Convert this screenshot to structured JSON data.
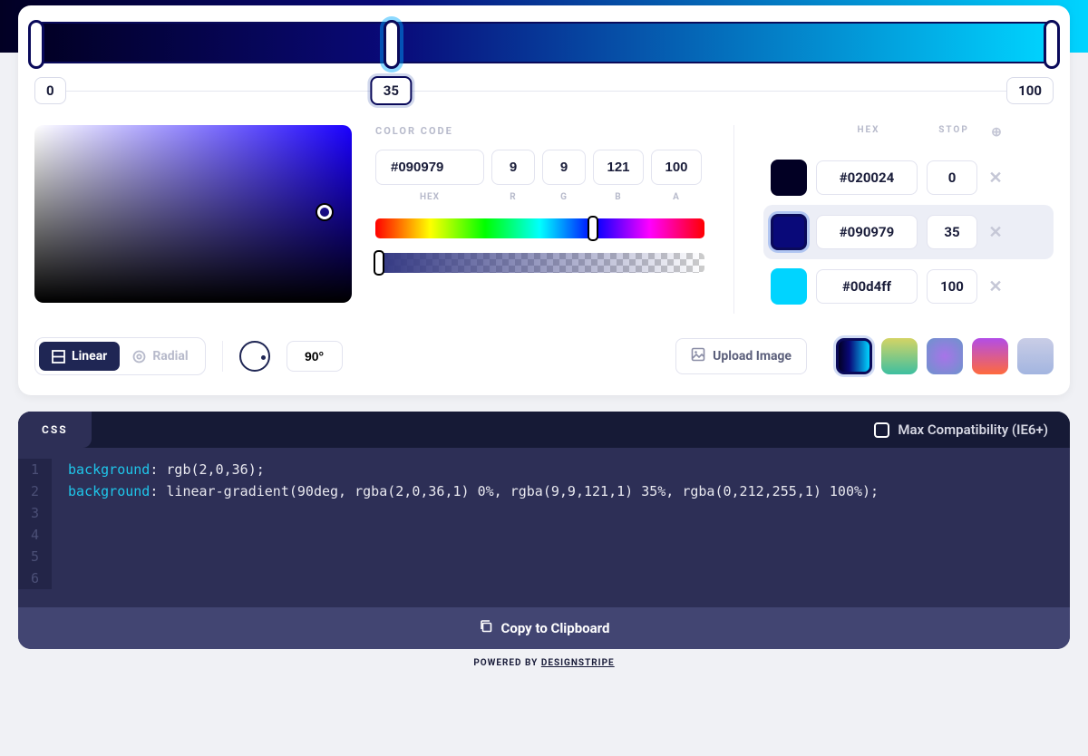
{
  "gradient": {
    "stops": [
      {
        "hex": "#020024",
        "stop": 0
      },
      {
        "hex": "#090979",
        "stop": 35
      },
      {
        "hex": "#00d4ff",
        "stop": 100
      }
    ],
    "active_stop_index": 1
  },
  "stop_inputs": {
    "left": "0",
    "mid": "35",
    "right": "100"
  },
  "color_code": {
    "label": "COLOR CODE",
    "hex": "#090979",
    "r": "9",
    "g": "9",
    "b": "121",
    "a": "100",
    "sublabels": {
      "hex": "HEX",
      "r": "R",
      "g": "G",
      "b": "B",
      "a": "A"
    }
  },
  "stops_panel": {
    "header": {
      "hex": "HEX",
      "stop": "STOP",
      "add": "⊕"
    },
    "items": [
      {
        "hex": "#020024",
        "stop": "0"
      },
      {
        "hex": "#090979",
        "stop": "35"
      },
      {
        "hex": "#00d4ff",
        "stop": "100"
      }
    ]
  },
  "type": {
    "linear": "Linear",
    "radial": "Radial",
    "angle": "90°"
  },
  "upload": {
    "label": "Upload Image"
  },
  "code": {
    "tab": "CSS",
    "compat_label": "Max Compatibility (IE6+)",
    "lines": [
      {
        "prop": "background",
        "val": ": rgb(2,0,36);"
      },
      {
        "prop": "background",
        "val": ": linear-gradient(90deg, rgba(2,0,36,1) 0%, rgba(9,9,121,1) 35%, rgba(0,212,255,1) 100%);"
      }
    ],
    "line_numbers": [
      "1",
      "2",
      "3",
      "4",
      "5",
      "6"
    ],
    "copy": "Copy to Clipboard"
  },
  "footer": {
    "powered": "POWERED BY ",
    "brand": "DESIGNSTRIPE"
  }
}
